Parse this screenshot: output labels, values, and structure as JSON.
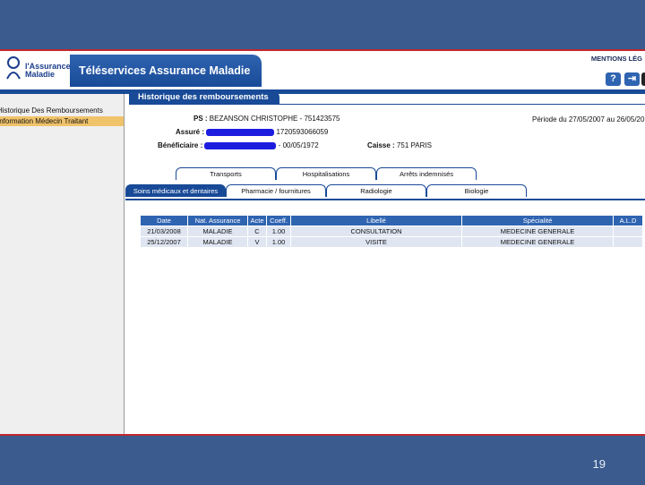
{
  "header": {
    "logo_text": "l'Assurance Maladie",
    "app_title": "Téléservices Assurance Maladie",
    "mentions": "MENTIONS LÉG",
    "help_label": "?",
    "exit_label": "⇥"
  },
  "sidebar": {
    "items": [
      {
        "label": "Historique Des Remboursements"
      },
      {
        "label": "Information Médecin Traitant"
      }
    ]
  },
  "page_tab": "Historique des remboursements",
  "info": {
    "ps_label": "PS :",
    "ps_value": "BEZANSON CHRISTOPHE - 751423575",
    "periode": "Période du 27/05/2007 au 26/05/20",
    "assure_label": "Assuré :",
    "assure_value": "1720593066059",
    "beneficiaire_label": "Bénéficiaire :",
    "beneficiaire_value": "- 00/05/1972",
    "caisse_label": "Caisse :",
    "caisse_value": "751 PARIS"
  },
  "tabs_row1": [
    "Transports",
    "Hospitalisations",
    "Arrêts indemnisés"
  ],
  "tabs_row2": [
    "Soins médicaux et dentaires",
    "Pharmacie / fournitures",
    "Radiologie",
    "Biologie"
  ],
  "table": {
    "headers": [
      "Date",
      "Nat. Assurance",
      "Acte",
      "Coeff.",
      "Libellé",
      "Spécialité",
      "A.L.D"
    ],
    "rows": [
      [
        "21/03/2008",
        "MALADIE",
        "C",
        "1.00",
        "CONSULTATION",
        "MEDECINE GENERALE",
        ""
      ],
      [
        "25/12/2007",
        "MALADIE",
        "V",
        "1.00",
        "VISITE",
        "MEDECINE GENERALE",
        ""
      ]
    ]
  },
  "slide": {
    "page_number": "19"
  },
  "colors": {
    "brand_blue": "#184a97",
    "accent_red": "#c0282d",
    "highlight": "#f0c36b",
    "slide_bg": "#3b5b8e"
  }
}
